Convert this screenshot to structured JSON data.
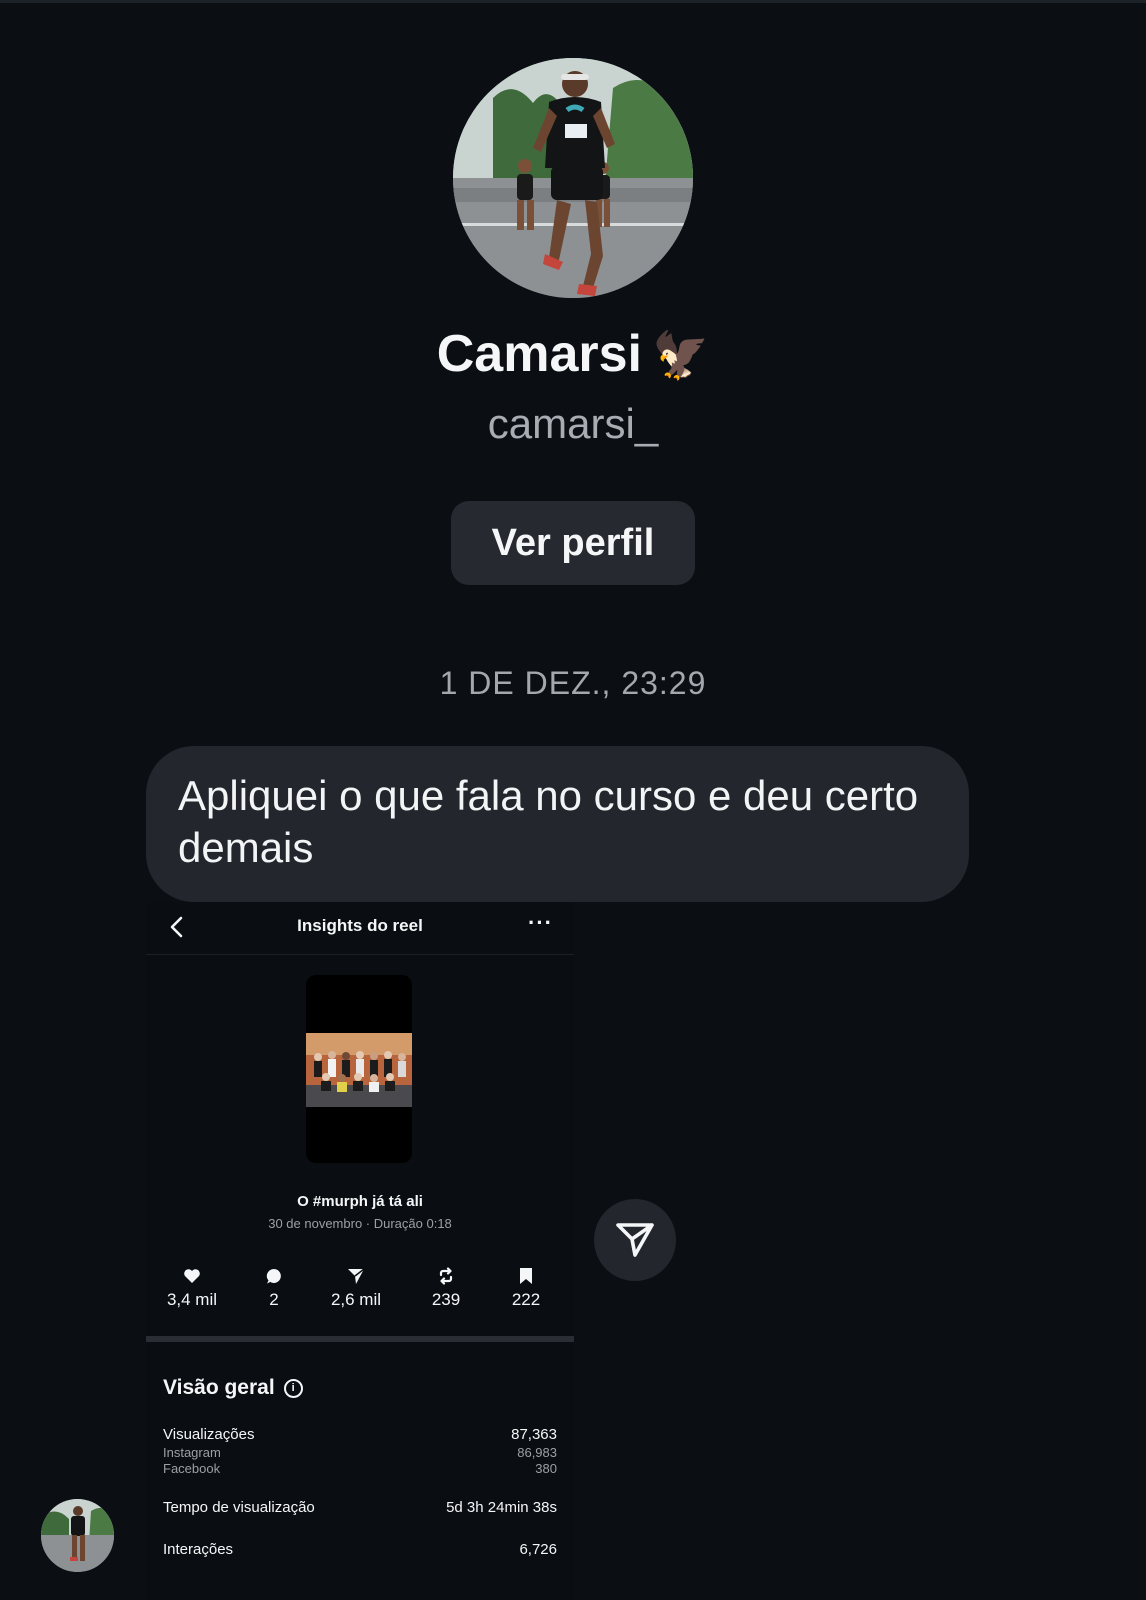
{
  "profile": {
    "name": "Camarsi",
    "name_emoji": "🦅",
    "handle": "camarsi_",
    "view_profile_label": "Ver perfil"
  },
  "thread": {
    "date_separator": "1 DE DEZ., 23:29",
    "message_text": "Apliquei o que fala no curso e deu certo demais"
  },
  "insights": {
    "title": "Insights do reel",
    "more_label": "···",
    "caption": "O #murph já tá ali",
    "meta": "30 de novembro · Duração 0:18",
    "stats": [
      {
        "icon": "heart-icon",
        "value": "3,4 mil"
      },
      {
        "icon": "comment-icon",
        "value": "2"
      },
      {
        "icon": "share-icon",
        "value": "2,6 mil"
      },
      {
        "icon": "repost-icon",
        "value": "239"
      },
      {
        "icon": "bookmark-icon",
        "value": "222"
      }
    ],
    "overview_title": "Visão geral",
    "rows": {
      "views_label": "Visualizações",
      "views_value": "87,363",
      "instagram_label": "Instagram",
      "instagram_value": "86,983",
      "facebook_label": "Facebook",
      "facebook_value": "380",
      "watch_time_label": "Tempo de visualização",
      "watch_time_value": "5d 3h 24min 38s",
      "interactions_label": "Interações",
      "interactions_value": "6,726"
    }
  },
  "colors": {
    "background": "#0b0f14",
    "bubble": "#23272d",
    "button": "#262a30",
    "muted_text": "#a8adb3"
  }
}
